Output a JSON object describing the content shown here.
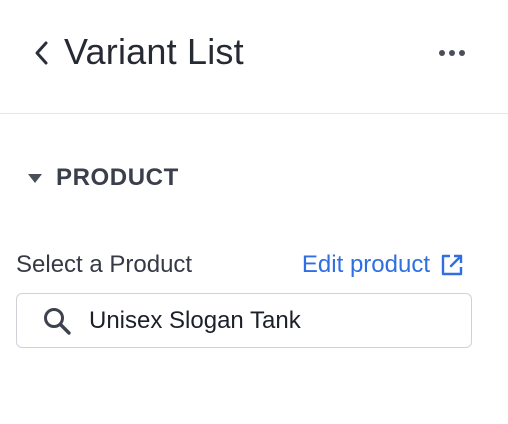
{
  "header": {
    "title": "Variant List",
    "back_icon": "chevron-left-icon",
    "more_icon": "more-horizontal-icon"
  },
  "section": {
    "title": "PRODUCT",
    "expanded": true,
    "caret_icon": "caret-down-icon"
  },
  "product_field": {
    "label": "Select a Product",
    "edit_link_label": "Edit product",
    "edit_link_icon": "external-link-icon",
    "search_icon": "search-icon",
    "value": "Unisex Slogan Tank",
    "placeholder": ""
  },
  "colors": {
    "link": "#2f6fe0",
    "text": "#262a33",
    "border": "#cfd2d8",
    "divider": "#e6e7ea"
  }
}
